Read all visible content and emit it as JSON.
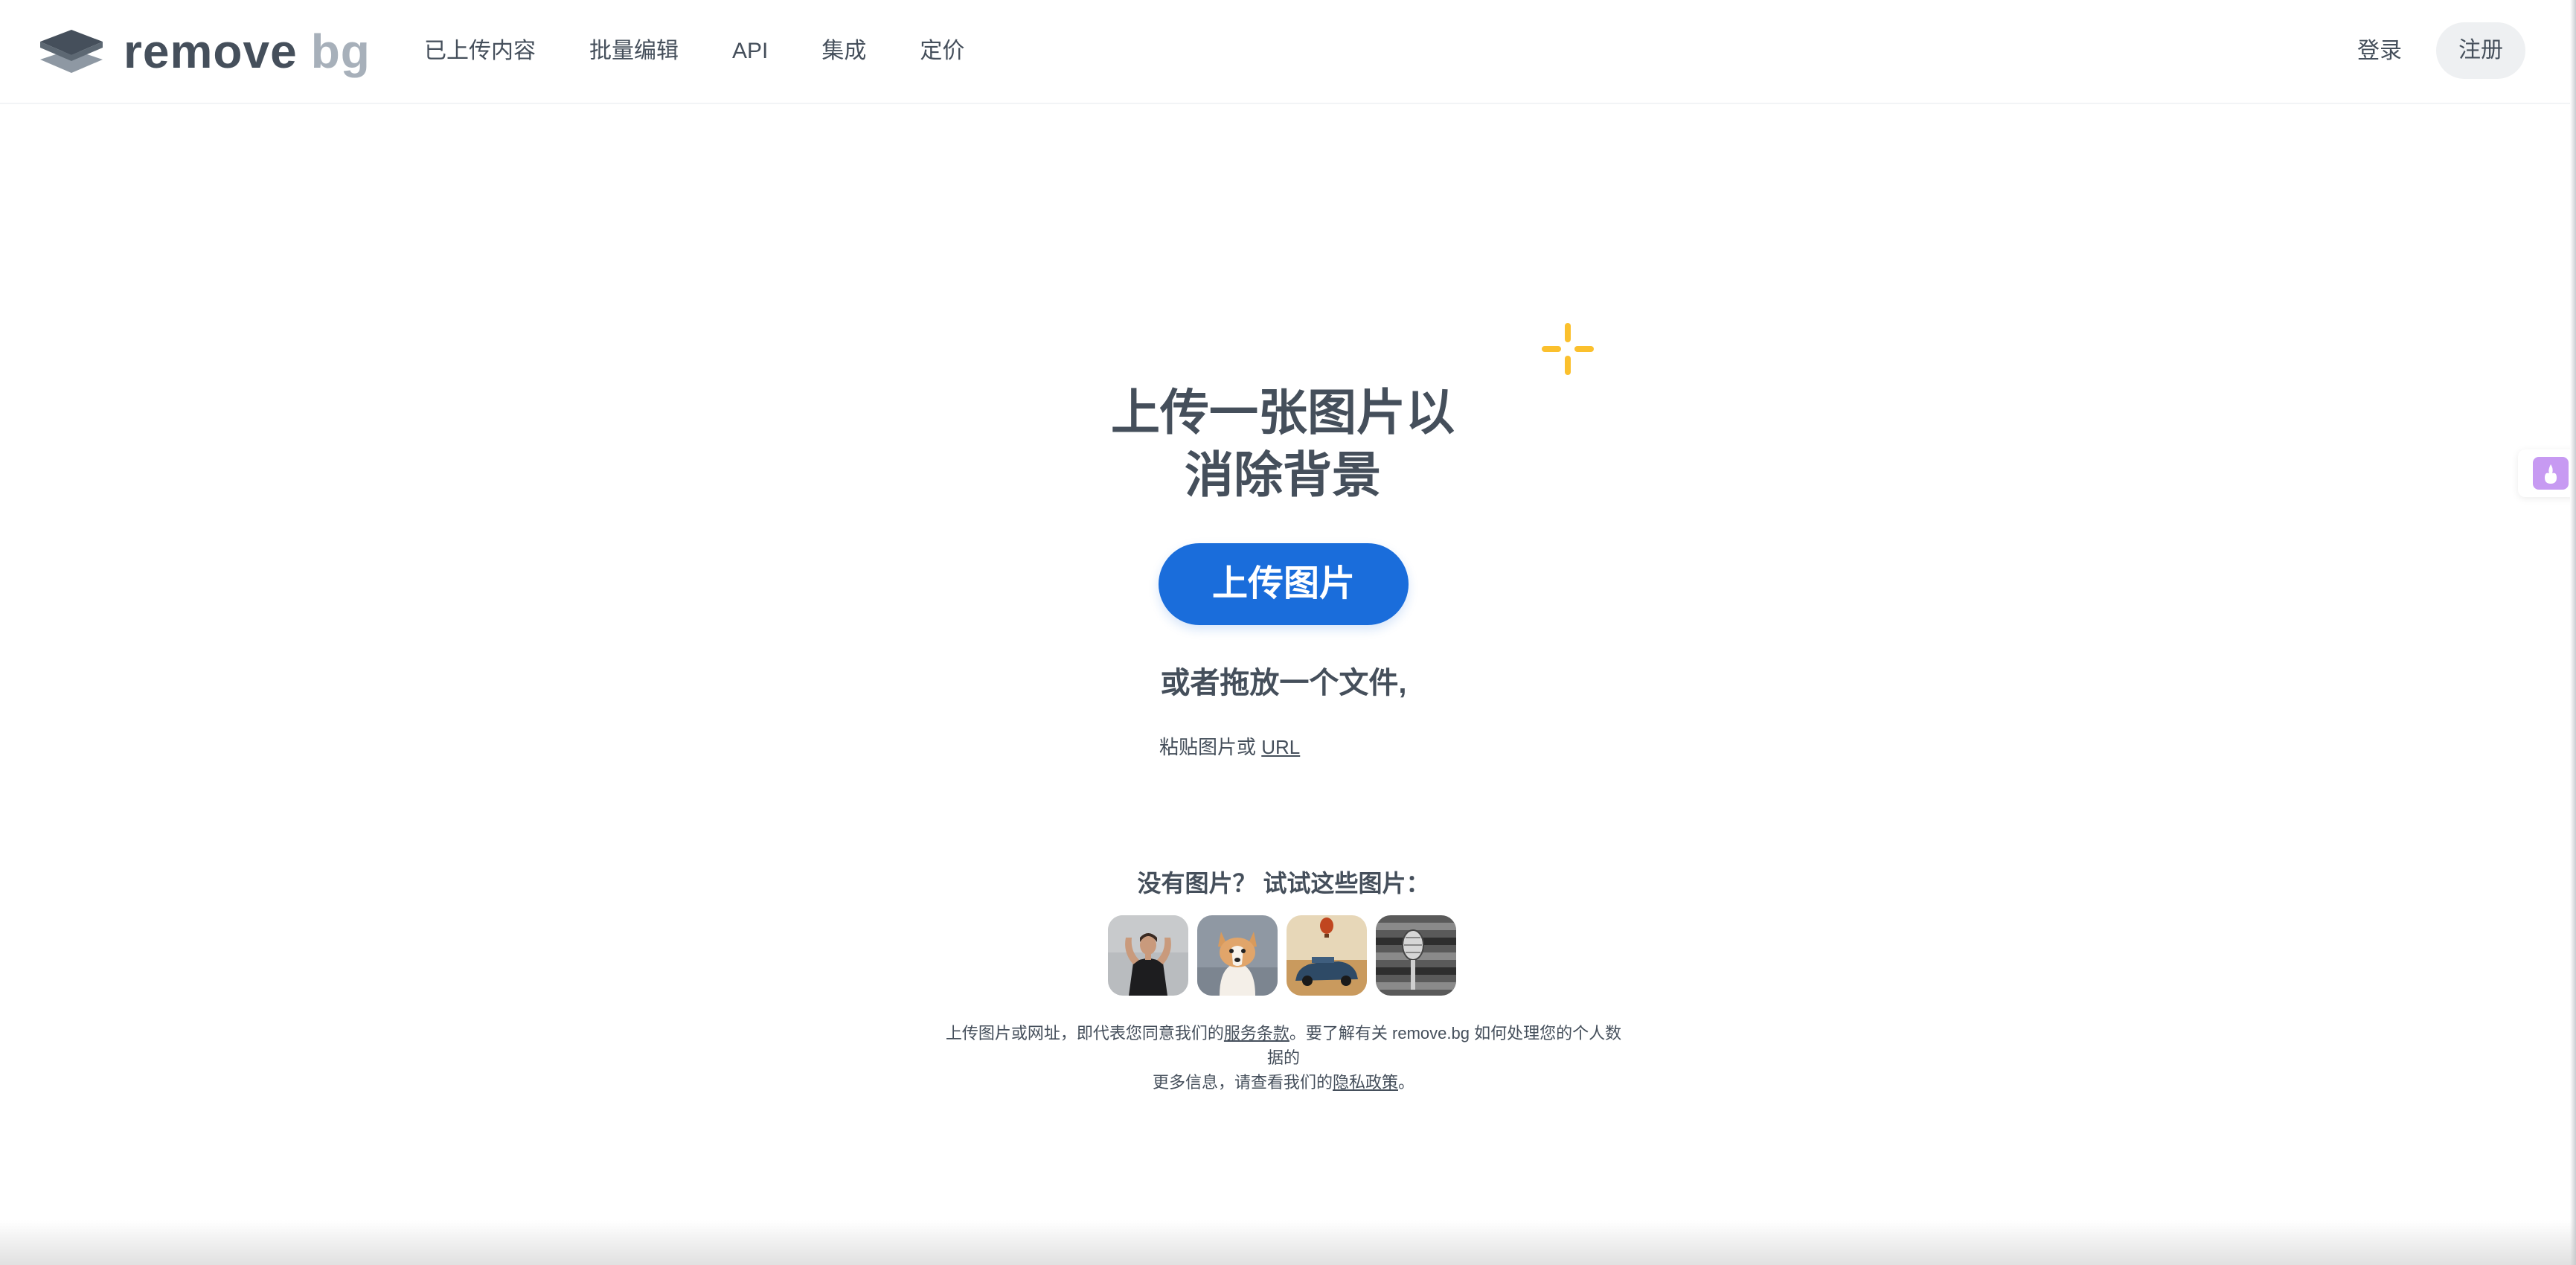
{
  "brand": {
    "word": "remove",
    "suffix": "bg"
  },
  "nav": {
    "items": [
      {
        "label": "已上传内容"
      },
      {
        "label": "批量编辑"
      },
      {
        "label": "API"
      },
      {
        "label": "集成"
      },
      {
        "label": "定价"
      }
    ],
    "login": "登录",
    "signup": "注册"
  },
  "hero": {
    "title_line1": "上传一张图片以",
    "title_line2": "消除背景",
    "upload_button": "上传图片",
    "drop_text": "或者拖放一个文件,",
    "paste_prefix": "粘贴图片或",
    "paste_link": "URL"
  },
  "samples": {
    "title": "没有图片？ 试试这些图片：",
    "images": [
      {
        "icon": "woman-flexing-photo"
      },
      {
        "icon": "corgi-dog-photo"
      },
      {
        "icon": "car-balloon-photo"
      },
      {
        "icon": "microphone-photo"
      }
    ]
  },
  "legal": {
    "part1": "上传图片或网址，即代表您同意我们的",
    "terms_link": "服务条款",
    "part2": "。要了解有关 remove.bg 如何处理您的个人数据的",
    "part3": "更多信息，请查看我们的",
    "privacy_link": "隐私政策",
    "part4": "。"
  },
  "colors": {
    "primary": "#1a6ddb",
    "text": "#454f5b",
    "logo_suffix": "#a7b0ba",
    "sparkle": "#fbc02d",
    "signup_bg": "#eef0f2"
  }
}
